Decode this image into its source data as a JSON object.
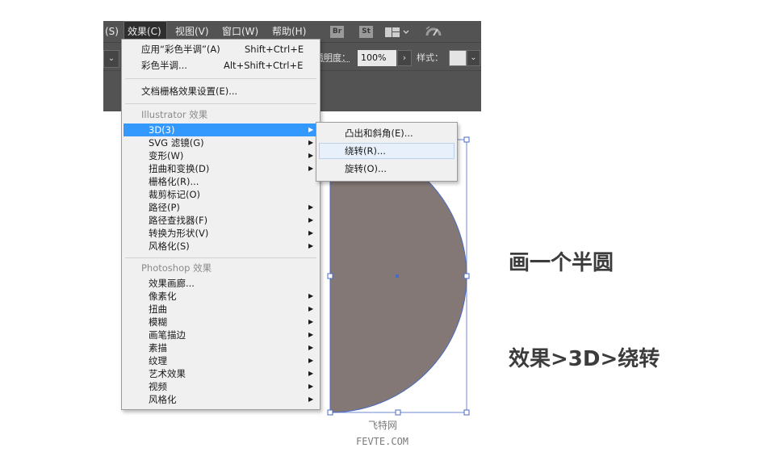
{
  "menubar": {
    "partial_prev": "(S)",
    "items": [
      {
        "label": "效果(C)"
      },
      {
        "label": "视图(V)"
      },
      {
        "label": "窗口(W)"
      },
      {
        "label": "帮助(H)"
      }
    ],
    "bridge": "Br",
    "stock": "St"
  },
  "toolbar": {
    "opacity_label": "透明度：",
    "opacity_value": "100%",
    "opacity_arrow": "›",
    "style_label": "样式：",
    "dropdown_glyph": "⌄"
  },
  "effect_menu": {
    "apply_label": "应用“彩色半调”(A)",
    "apply_shortcut": "Shift+Ctrl+E",
    "last_label": "彩色半调...",
    "last_shortcut": "Alt+Shift+Ctrl+E",
    "doc_raster": "文档栅格效果设置(E)...",
    "illustrator_header": "Illustrator 效果",
    "illustrator_items": [
      {
        "label": "3D(3)",
        "submenu": true
      },
      {
        "label": "SVG 滤镜(G)",
        "submenu": true
      },
      {
        "label": "变形(W)",
        "submenu": true
      },
      {
        "label": "扭曲和变换(D)",
        "submenu": true
      },
      {
        "label": "栅格化(R)...",
        "submenu": false
      },
      {
        "label": "裁剪标记(O)",
        "submenu": false
      },
      {
        "label": "路径(P)",
        "submenu": true
      },
      {
        "label": "路径查找器(F)",
        "submenu": true
      },
      {
        "label": "转换为形状(V)",
        "submenu": true
      },
      {
        "label": "风格化(S)",
        "submenu": true
      }
    ],
    "photoshop_header": "Photoshop 效果",
    "photoshop_items": [
      {
        "label": "效果画廊...",
        "submenu": false
      },
      {
        "label": "像素化",
        "submenu": true
      },
      {
        "label": "扭曲",
        "submenu": true
      },
      {
        "label": "模糊",
        "submenu": true
      },
      {
        "label": "画笔描边",
        "submenu": true
      },
      {
        "label": "素描",
        "submenu": true
      },
      {
        "label": "纹理",
        "submenu": true
      },
      {
        "label": "艺术效果",
        "submenu": true
      },
      {
        "label": "视频",
        "submenu": true
      },
      {
        "label": "风格化",
        "submenu": true
      }
    ],
    "arrow_glyph": "▶"
  },
  "submenu_3d": {
    "items": [
      {
        "label": "凸出和斜角(E)..."
      },
      {
        "label": "绕转(R)..."
      },
      {
        "label": "旋转(O)..."
      }
    ]
  },
  "captions": {
    "step1": "画一个半圆",
    "step2": "效果>3D>绕转"
  },
  "watermark": {
    "cn": "飞特网",
    "en": "FEVTE.COM"
  },
  "colors": {
    "shape_fill": "#847876",
    "selection": "#4a6bc4",
    "highlight": "#3399ff"
  }
}
